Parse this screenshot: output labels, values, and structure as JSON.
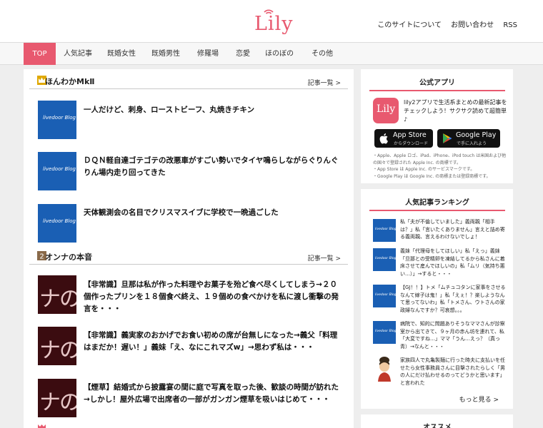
{
  "header": {
    "logo": "Lily",
    "links": [
      "このサイトについて",
      "お問い合わせ",
      "RSS"
    ]
  },
  "nav": [
    {
      "label": "TOP",
      "active": true
    },
    {
      "label": "人気記事"
    },
    {
      "label": "既婚女性"
    },
    {
      "label": "既婚男性"
    },
    {
      "label": "修羅場"
    },
    {
      "label": "恋愛"
    },
    {
      "label": "ほのぼの"
    },
    {
      "label": "その他"
    }
  ],
  "sections": [
    {
      "title": "ほんわかMkⅡ",
      "icon": "crown-icon",
      "more": "記事一覧 >",
      "thumb_text": "livedoor Blog",
      "entries": [
        "一人だけど、刺身、ローストビーフ、丸焼きチキン",
        "ＤＱＮ軽自達ゴテゴテの改悪車がすごい勢いでタイヤ鳴らしながらぐりんぐりん場内走り回ってきた",
        "天体観測会の名目でクリスマスイブに学校で一晩過ごした"
      ]
    },
    {
      "title": "オンナの本音",
      "icon": "number-2-badge-icon",
      "more": "記事一覧 >",
      "thumb_text": "ナのス",
      "entries": [
        "【非常識】旦那は私が作った料理やお菓子を殆ど食べ尽くしてしまう→２０個作ったプリンを１８個食べ終え、１９個めの食べかけを私に渡し衝撃の発言を・・・",
        "【非常識】義実家のおかげでお食い初めの席が台無しになった→義父「料理はまだか！遅い！」義妹「え、なにこれマズw」→思わず私は・・・",
        "【煙草】結婚式から披露宴の間に庭で写真を取った後、歓談の時間が訪れた→しかし！屋外広場で出席者の一部がガンガン煙草を吸いはじめて・・・"
      ]
    }
  ],
  "sidebar": {
    "app": {
      "title": "公式アプリ",
      "icon_text": "Lily",
      "description": "lily2アプリで生活系まとめの最新記事をチェックしよう！サクサク読めて超簡単♪",
      "app_store": {
        "label": "App Store",
        "sub": "からダウンロード"
      },
      "google_play": {
        "label": "Google Play",
        "sub": "で手に入れよう"
      },
      "note": "・Apple、Apple ロゴ、iPad、iPhone、iPod touch は米国および他の国々で登録された Apple Inc. の商標です。\n・App Store は Apple Inc. のサービスマークです。\n・Google Play は Google Inc. の商標または登録商標です。"
    },
    "ranking": {
      "title": "人気記事ランキング",
      "thumb_text": "livedoor Blog",
      "items": [
        "私「夫が不倫していました」義両親「相手は？」私「言いたくありません」言えと詰め寄る義両親、言えるわけないでしょ！",
        "義妹「代理母をしてほしい」私「えっ」義妹「旦那との受精卵を凍結してるから私さんに着床させて産んでほしいの」私「ムリ（気持ち悪い…）」→すると・・・",
        "【GJ！！】トメ「ムチュコタンに家事をさせるなんて嫁子は鬼！」私「えぇ！？楽しようなんて思ってないわ」私「トメさん、ウトさんの家政婦なんですか？可哀想。。。",
        "病院で、知的に問題ありそうなママさんが診察室から出てきて、９ヶ月の赤ん坊を連れて、私「大変ですね…」ママ「うん…えっ？（真っ青）→なんと・・・",
        "家族四人で丸亀製麺に行った時夫に支払いを任せたら女性事務員さんに目撃されたらしく「男の人にだけ払わせるのってどうかと思います」と言われた"
      ],
      "more": "もっと見る >"
    },
    "recommend": {
      "title": "オススメ"
    }
  },
  "colors": {
    "accent": "#e8596f",
    "blog_blue": "#1a5fb4",
    "dark_thumb": "#3b0c10"
  }
}
